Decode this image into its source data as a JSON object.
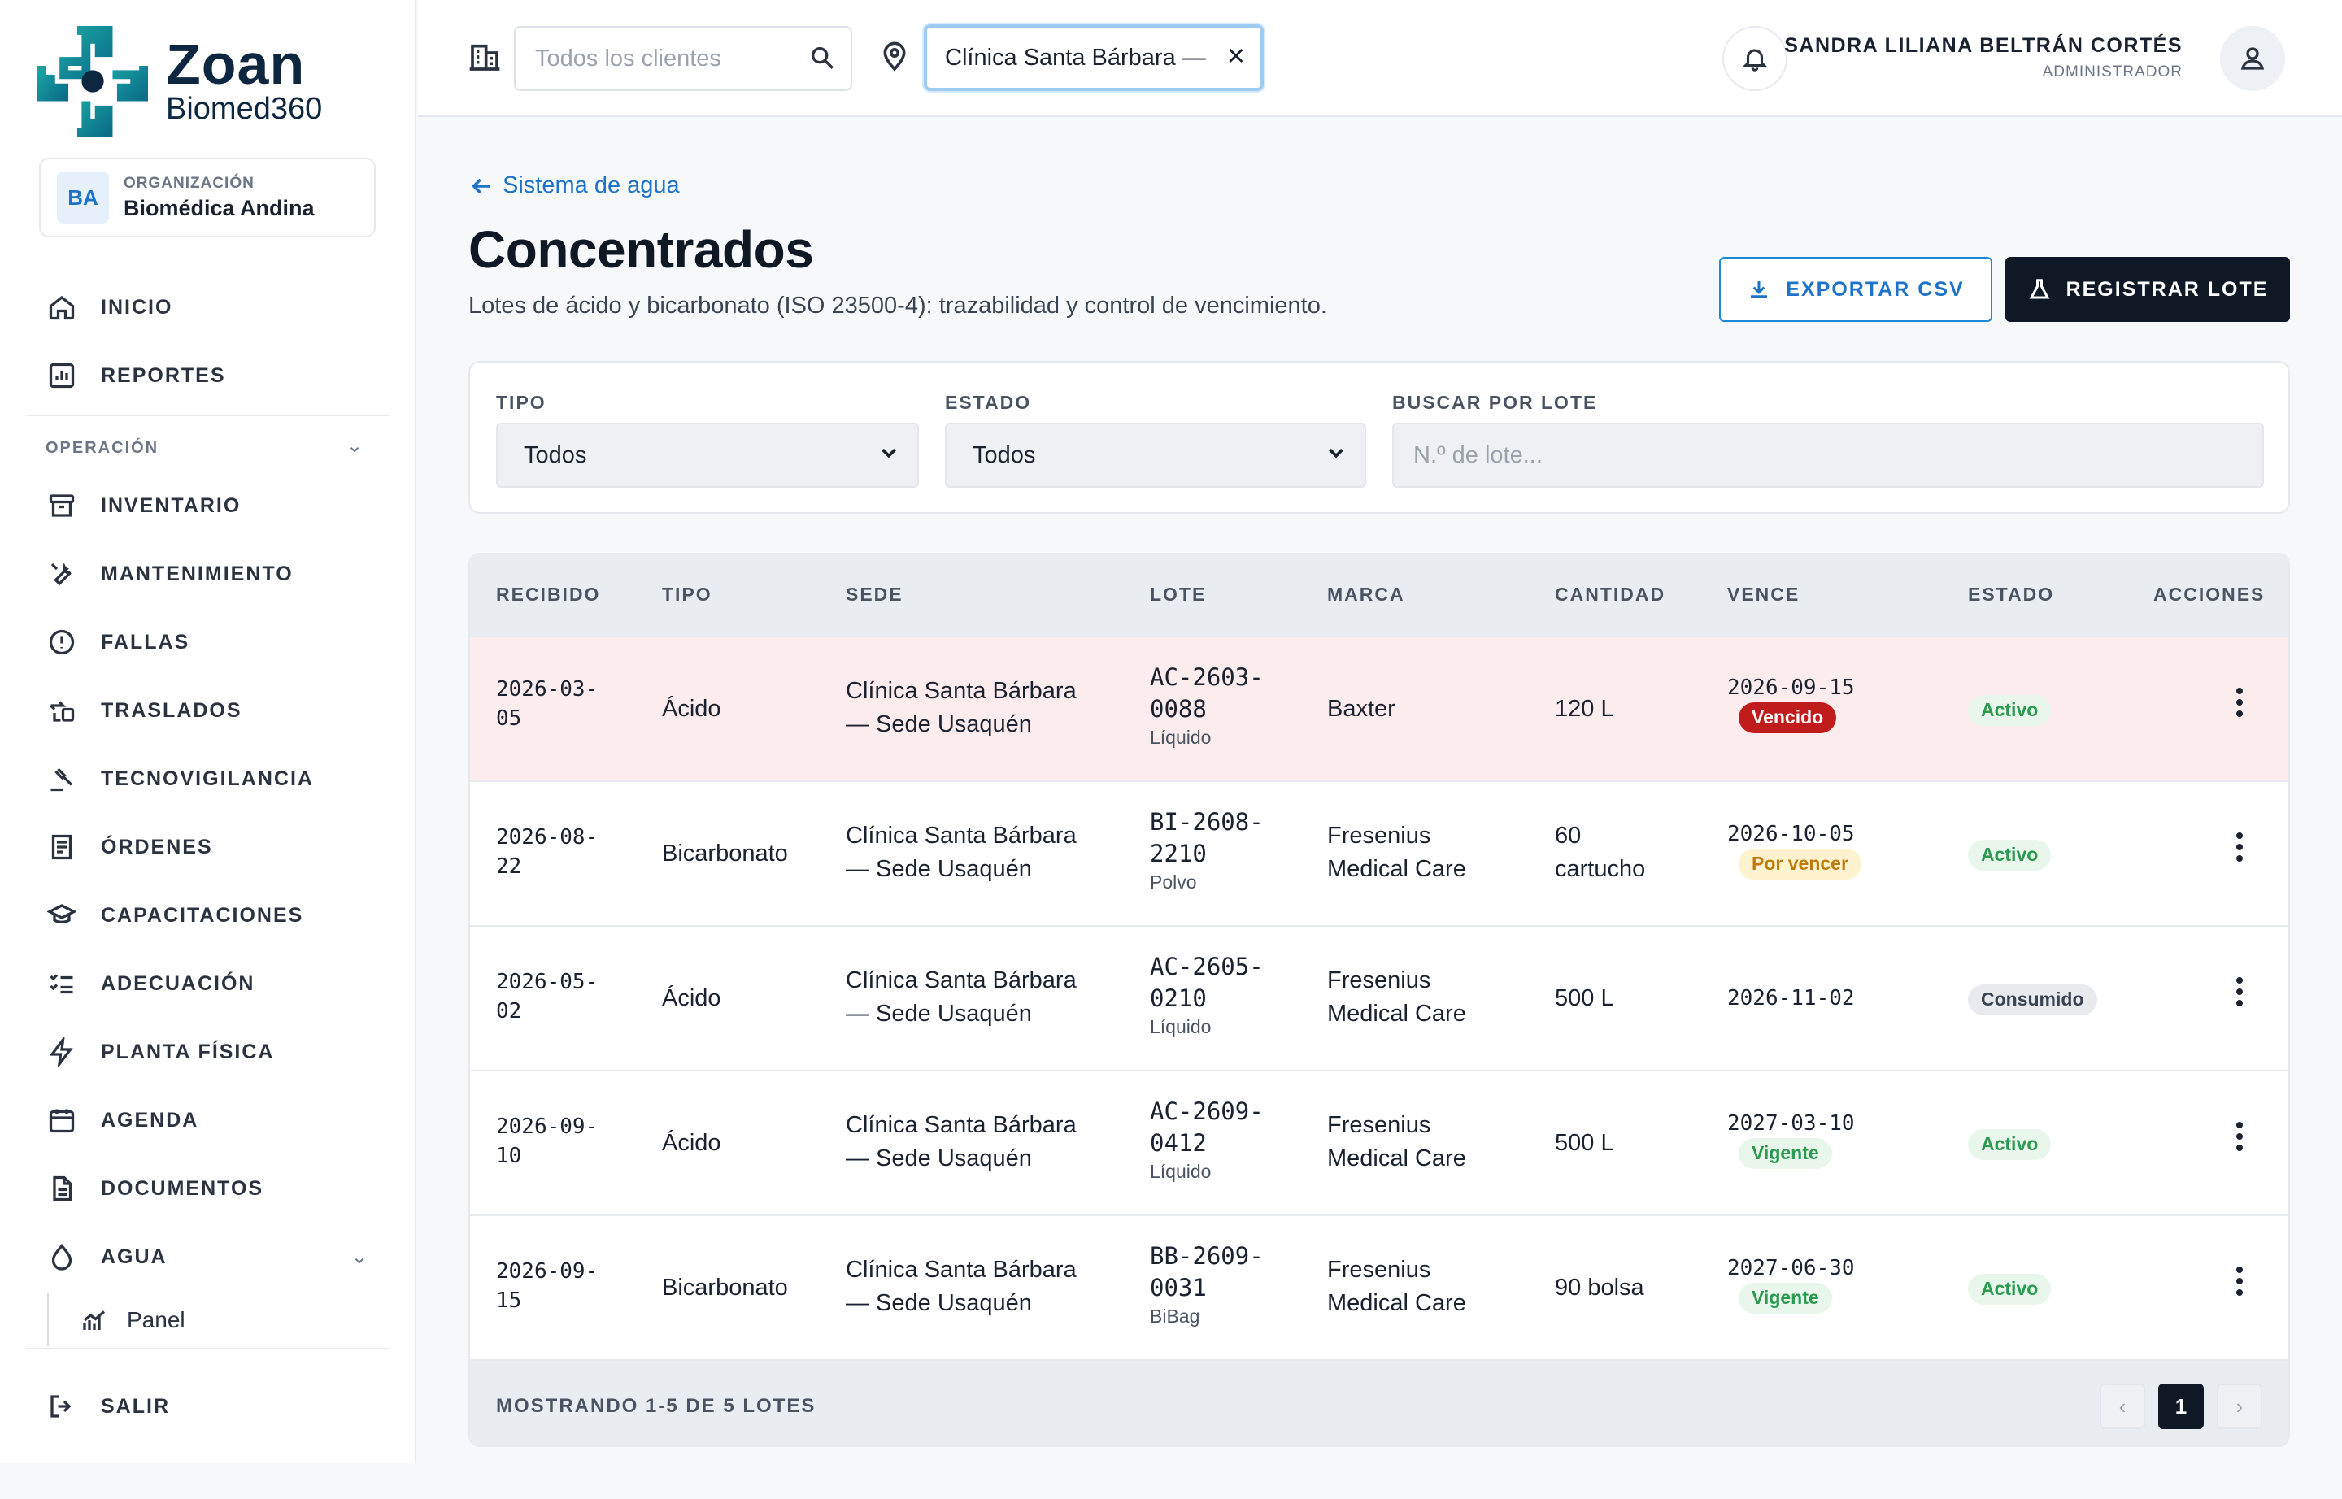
{
  "brand": {
    "name": "Zoan",
    "subtitle": "Biomed360"
  },
  "organization": {
    "label": "ORGANIZACIÓN",
    "initials": "BA",
    "name": "Biomédica Andina"
  },
  "sidebar": {
    "top_items": [
      {
        "label": "INICIO",
        "icon": "home-icon"
      },
      {
        "label": "REPORTES",
        "icon": "chart-icon"
      }
    ],
    "section_title": "OPERACIÓN",
    "items": [
      {
        "label": "INVENTARIO",
        "icon": "archive-icon"
      },
      {
        "label": "MANTENIMIENTO",
        "icon": "wrench-icon"
      },
      {
        "label": "FALLAS",
        "icon": "alert-icon"
      },
      {
        "label": "TRASLADOS",
        "icon": "transfer-icon"
      },
      {
        "label": "TECNOVIGILANCIA",
        "icon": "gavel-icon"
      },
      {
        "label": "ÓRDENES",
        "icon": "receipt-icon"
      },
      {
        "label": "CAPACITACIONES",
        "icon": "graduation-icon"
      },
      {
        "label": "ADECUACIÓN",
        "icon": "checklist-icon"
      },
      {
        "label": "PLANTA FÍSICA",
        "icon": "bolt-icon"
      },
      {
        "label": "AGENDA",
        "icon": "calendar-icon"
      },
      {
        "label": "DOCUMENTOS",
        "icon": "document-icon"
      },
      {
        "label": "AGUA",
        "icon": "droplet-icon"
      }
    ],
    "sub_item": {
      "label": "Panel",
      "icon": "panel-chart-icon"
    },
    "logout": {
      "label": "SALIR",
      "icon": "logout-icon"
    }
  },
  "header": {
    "client_placeholder": "Todos los clientes",
    "site_value": "Clínica Santa Bárbara —",
    "user_name": "SANDRA LILIANA BELTRÁN CORTÉS",
    "user_role": "ADMINISTRADOR"
  },
  "page": {
    "back_label": "Sistema de agua",
    "title": "Concentrados",
    "description": "Lotes de ácido y bicarbonato (ISO 23500-4): trazabilidad y control de vencimiento.",
    "export_label": "EXPORTAR CSV",
    "register_label": "REGISTRAR LOTE"
  },
  "filters": {
    "tipo_label": "TIPO",
    "tipo_value": "Todos",
    "estado_label": "ESTADO",
    "estado_value": "Todos",
    "search_label": "BUSCAR POR LOTE",
    "search_placeholder": "N.º de lote..."
  },
  "table": {
    "headers": [
      "RECIBIDO",
      "TIPO",
      "SEDE",
      "LOTE",
      "MARCA",
      "CANTIDAD",
      "VENCE",
      "ESTADO",
      "ACCIONES"
    ],
    "rows": [
      {
        "recibido_a": "2026-03-",
        "recibido_b": "05",
        "tipo": "Ácido",
        "sede_a": "Clínica Santa Bárbara",
        "sede_b": "— Sede Usaquén",
        "lote_a": "AC-2603-",
        "lote_b": "0088",
        "presentacion": "Líquido",
        "marca_a": "Baxter",
        "marca_b": "",
        "cantidad_a": "120 L",
        "cantidad_b": "",
        "vence": "2026-09-15",
        "vence_badge": "Vencido",
        "estado": "Activo"
      },
      {
        "recibido_a": "2026-08-",
        "recibido_b": "22",
        "tipo": "Bicarbonato",
        "sede_a": "Clínica Santa Bárbara",
        "sede_b": "— Sede Usaquén",
        "lote_a": "BI-2608-",
        "lote_b": "2210",
        "presentacion": "Polvo",
        "marca_a": "Fresenius",
        "marca_b": "Medical Care",
        "cantidad_a": "60",
        "cantidad_b": "cartucho",
        "vence": "2026-10-05",
        "vence_badge": "Por vencer",
        "estado": "Activo"
      },
      {
        "recibido_a": "2026-05-",
        "recibido_b": "02",
        "tipo": "Ácido",
        "sede_a": "Clínica Santa Bárbara",
        "sede_b": "— Sede Usaquén",
        "lote_a": "AC-2605-",
        "lote_b": "0210",
        "presentacion": "Líquido",
        "marca_a": "Fresenius",
        "marca_b": "Medical Care",
        "cantidad_a": "500 L",
        "cantidad_b": "",
        "vence": "2026-11-02",
        "vence_badge": "",
        "estado": "Consumido"
      },
      {
        "recibido_a": "2026-09-",
        "recibido_b": "10",
        "tipo": "Ácido",
        "sede_a": "Clínica Santa Bárbara",
        "sede_b": "— Sede Usaquén",
        "lote_a": "AC-2609-",
        "lote_b": "0412",
        "presentacion": "Líquido",
        "marca_a": "Fresenius",
        "marca_b": "Medical Care",
        "cantidad_a": "500 L",
        "cantidad_b": "",
        "vence": "2027-03-10",
        "vence_badge": "Vigente",
        "estado": "Activo"
      },
      {
        "recibido_a": "2026-09-",
        "recibido_b": "15",
        "tipo": "Bicarbonato",
        "sede_a": "Clínica Santa Bárbara",
        "sede_b": "— Sede Usaquén",
        "lote_a": "BB-2609-",
        "lote_b": "0031",
        "presentacion": "BiBag",
        "marca_a": "Fresenius",
        "marca_b": "Medical Care",
        "cantidad_a": "90 bolsa",
        "cantidad_b": "",
        "vence": "2027-06-30",
        "vence_badge": "Vigente",
        "estado": "Activo"
      }
    ],
    "footer_text": "MOSTRANDO 1-5 DE 5 LOTES",
    "current_page": "1",
    "prev_symbol": "‹",
    "next_symbol": "›"
  },
  "colors": {
    "accent": "#1d73c8",
    "dark": "#0f1825",
    "danger_row": "#fdeced",
    "vencido": "#c01c1c",
    "activo": "#2a9a4f",
    "por_vencer": "#c07c0a"
  }
}
